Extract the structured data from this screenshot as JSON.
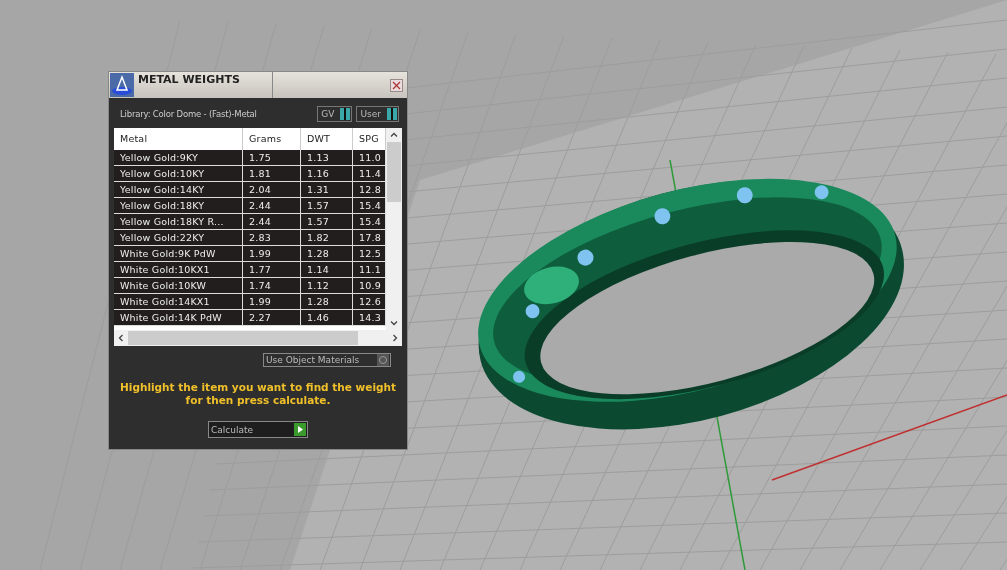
{
  "dialog": {
    "title": "METAL WEIGHTS",
    "library": "Library: Color Dome - (Fast)-Metal",
    "toggles": [
      {
        "label": "GV",
        "on": true
      },
      {
        "label": "User",
        "on": true
      }
    ],
    "table": {
      "columns": [
        "Metal",
        "Grams",
        "DWT",
        "SPG"
      ],
      "rows": [
        [
          "Yellow Gold:9KY",
          "1.75",
          "1.13",
          "11.0"
        ],
        [
          "Yellow Gold:10KY",
          "1.81",
          "1.16",
          "11.4"
        ],
        [
          "Yellow Gold:14KY",
          "2.04",
          "1.31",
          "12.8"
        ],
        [
          "Yellow Gold:18KY",
          "2.44",
          "1.57",
          "15.4"
        ],
        [
          "Yellow Gold:18KY R...",
          "2.44",
          "1.57",
          "15.4"
        ],
        [
          "Yellow Gold:22KY",
          "2.83",
          "1.82",
          "17.8"
        ],
        [
          "White Gold:9K PdW",
          "1.99",
          "1.28",
          "12.5"
        ],
        [
          "White Gold:10KX1",
          "1.77",
          "1.14",
          "11.1"
        ],
        [
          "White Gold:10KW",
          "1.74",
          "1.12",
          "10.9"
        ],
        [
          "White Gold:14KX1",
          "1.99",
          "1.28",
          "12.6"
        ],
        [
          "White Gold:14K PdW",
          "2.27",
          "1.46",
          "14.3"
        ]
      ]
    },
    "use_object_materials": {
      "label": "Use Object Materials",
      "checked": false
    },
    "hint": "Highlight the item you want to find the weight for then press calculate.",
    "calculate_button": "Calculate"
  }
}
